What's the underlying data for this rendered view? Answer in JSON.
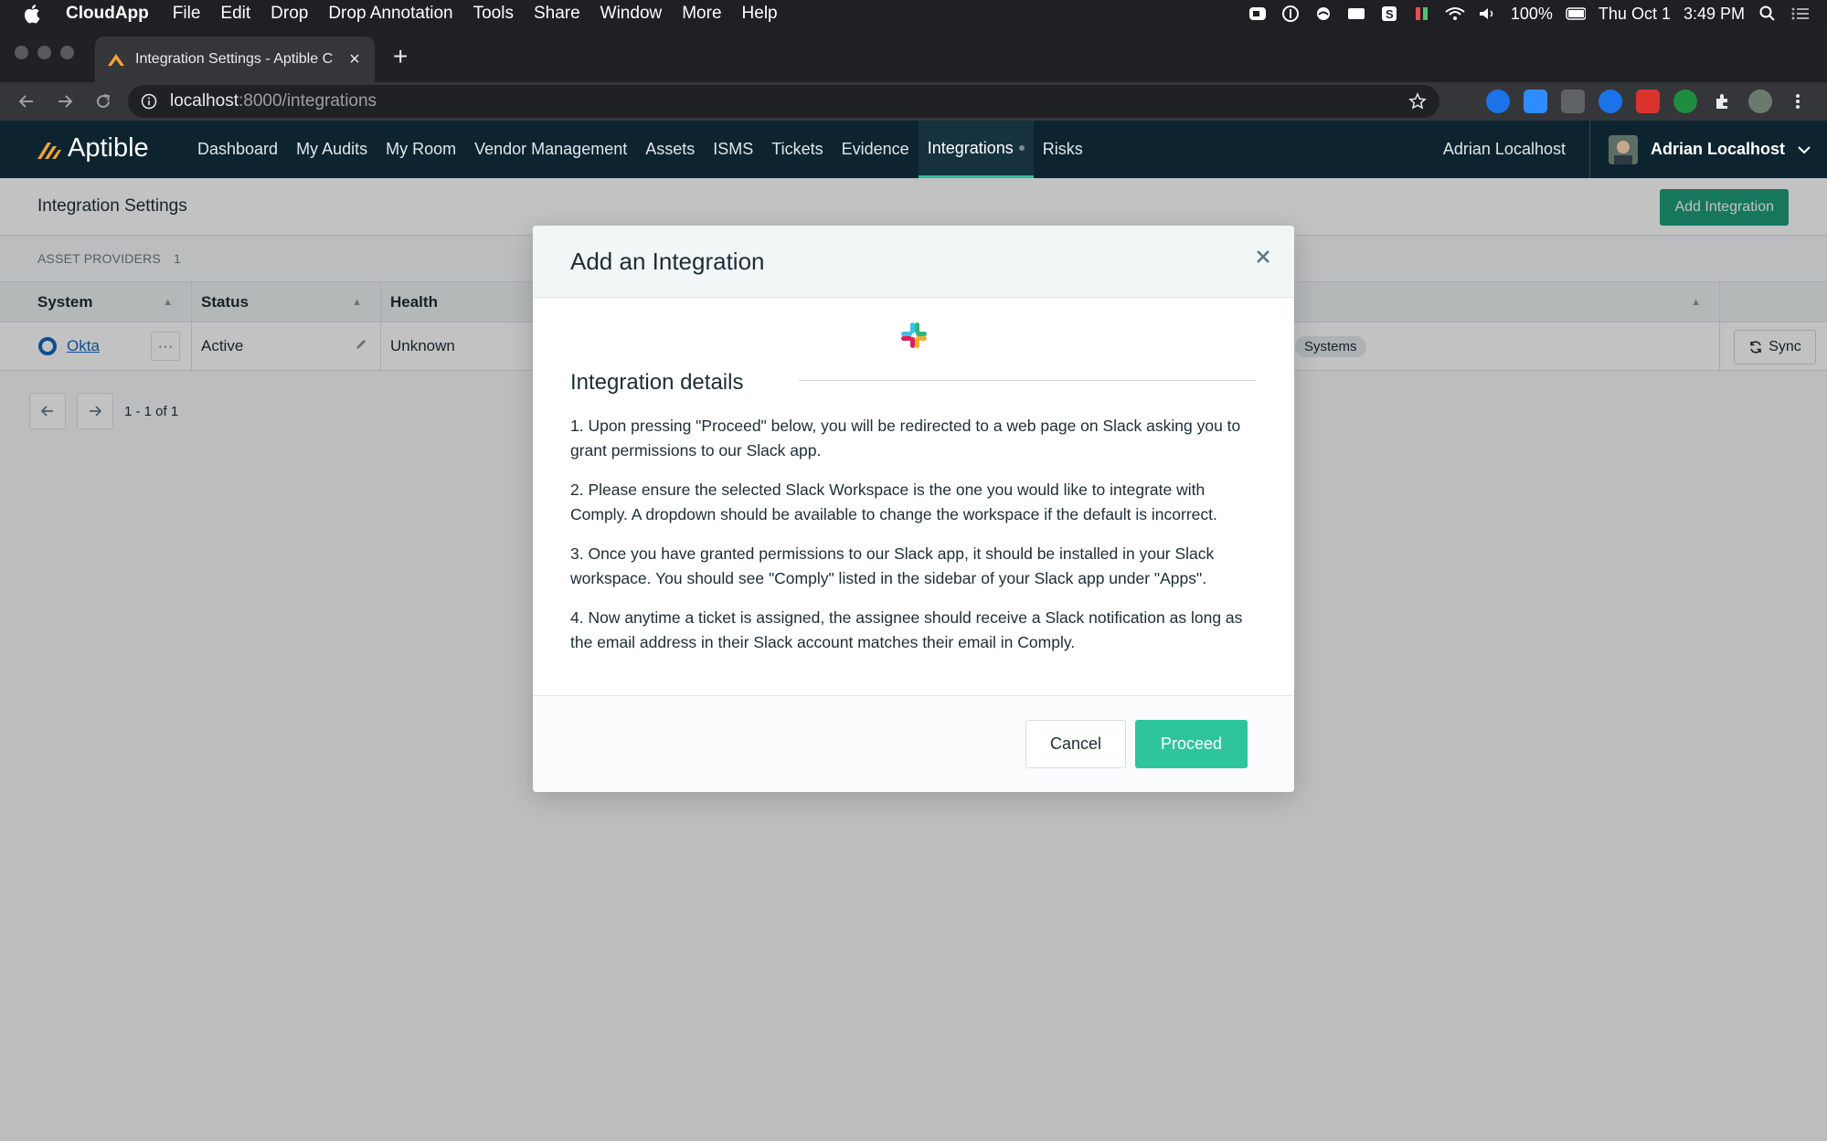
{
  "menubar": {
    "app": "CloudApp",
    "items": [
      "File",
      "Edit",
      "Drop",
      "Drop Annotation",
      "Tools",
      "Share",
      "Window",
      "More",
      "Help"
    ],
    "battery": "100%",
    "date": "Thu Oct 1",
    "time": "3:49 PM"
  },
  "browser": {
    "tab_title": "Integration Settings - Aptible C",
    "url_host": "localhost",
    "url_path": ":8000/integrations"
  },
  "appnav": {
    "brand": "Aptible",
    "links": [
      "Dashboard",
      "My Audits",
      "My Room",
      "Vendor Management",
      "Assets",
      "ISMS",
      "Tickets",
      "Evidence",
      "Integrations",
      "Risks"
    ],
    "org": "Adrian Localhost",
    "user": "Adrian Localhost"
  },
  "page": {
    "title": "Integration Settings",
    "add_button": "Add Integration",
    "section": "ASSET PROVIDERS",
    "section_count": "1",
    "columns": [
      "System",
      "Status",
      "Health"
    ],
    "row": {
      "system": "Okta",
      "status": "Active",
      "health": "Unknown",
      "chip": "Systems",
      "sync": "Sync"
    },
    "pager": "1 - 1 of 1"
  },
  "modal": {
    "title": "Add an Integration",
    "details_title": "Integration details",
    "steps": [
      "1. Upon pressing \"Proceed\" below, you will be redirected to a web page on Slack asking you to grant permissions to our Slack app.",
      "2. Please ensure the selected Slack Workspace is the one you would like to integrate with Comply. A dropdown should be available to change the workspace if the default is incorrect.",
      "3. Once you have granted permissions to our Slack app, it should be installed in your Slack workspace. You should see \"Comply\" listed in the sidebar of your Slack app under \"Apps\".",
      "4. Now anytime a ticket is assigned, the assignee should receive a Slack notification as long as the email address in their Slack account matches their email in Comply."
    ],
    "cancel": "Cancel",
    "proceed": "Proceed"
  },
  "colors": {
    "accent": "#2ec59b",
    "nav_bg": "#0d2430",
    "link": "#1466c0"
  }
}
